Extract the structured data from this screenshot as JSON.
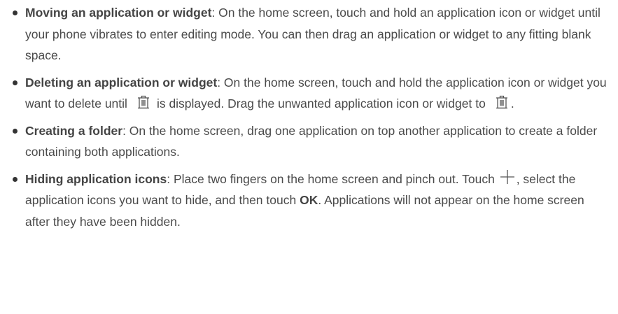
{
  "items": [
    {
      "term": "Moving an application or widget",
      "text": ": On the home screen, touch and hold an application icon or widget until your phone vibrates to enter editing mode. You can then drag an application or widget to any fitting blank space."
    },
    {
      "term": "Deleting an application or widget",
      "text_a": ": On the home screen, touch and hold the application icon or widget you want to delete until",
      "text_b": "is displayed. Drag the unwanted application icon or widget to",
      "text_c": "."
    },
    {
      "term": "Creating a folder",
      "text": ": On the home screen, drag one application on top another application to create a folder containing both applications."
    },
    {
      "term": "Hiding application icons",
      "text_a": ": Place two fingers on the home screen and pinch out. Touch",
      "text_b": ", select the application icons you want to hide, and then touch",
      "ok_label": "OK",
      "text_c": ". Applications will not appear on the home screen after they have been hidden."
    }
  ],
  "icons": {
    "trash": "trash-icon",
    "plus": "plus-icon"
  },
  "colors": {
    "text": "#4a4a4a",
    "bullet": "#333333"
  }
}
